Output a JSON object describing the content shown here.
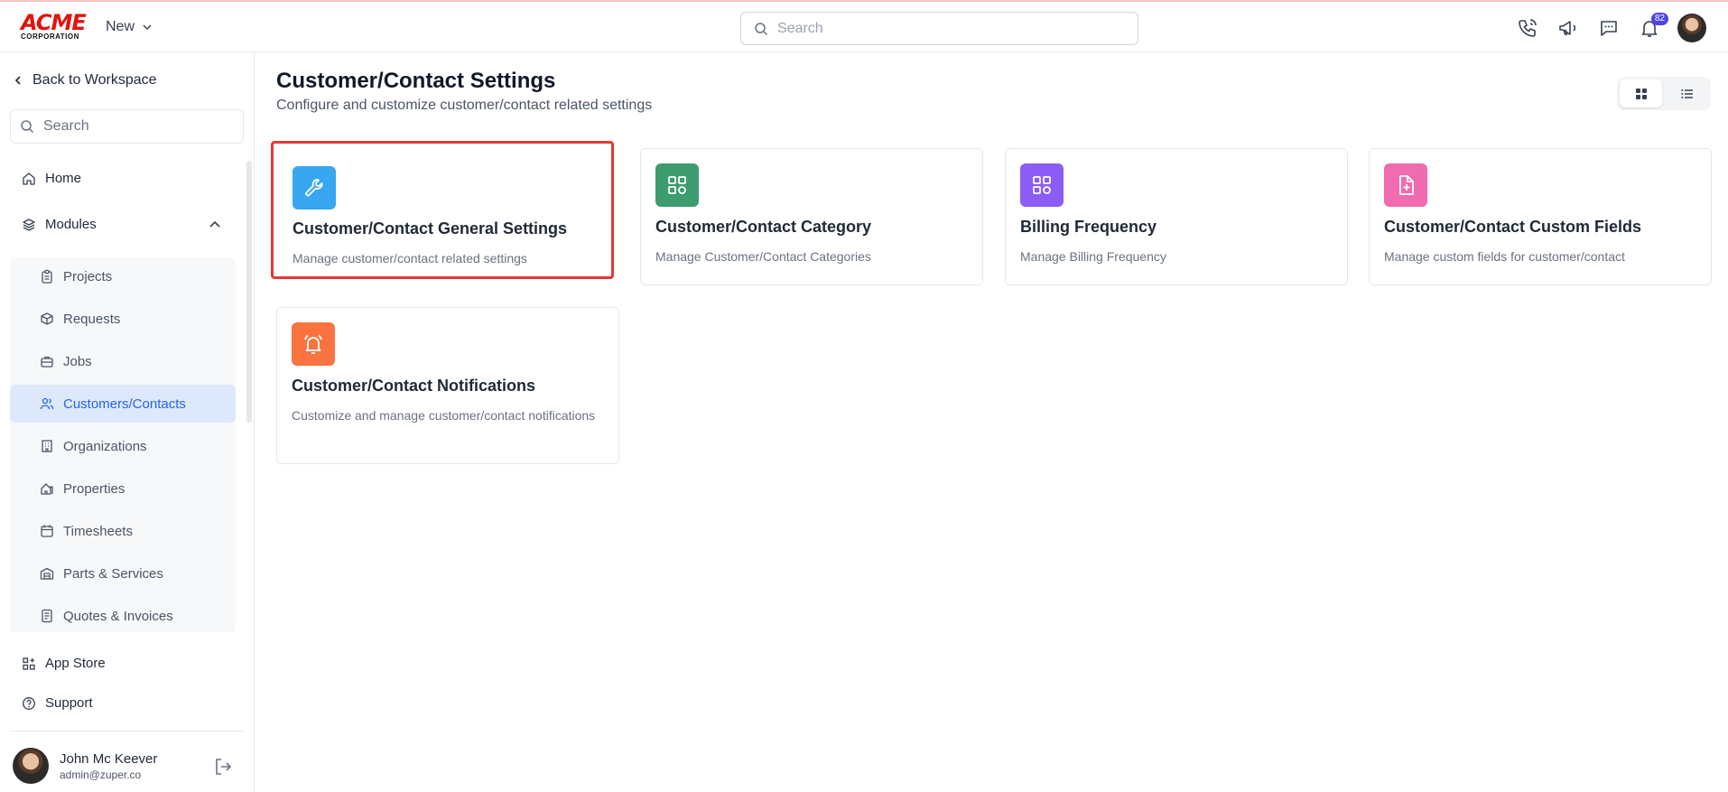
{
  "brand": {
    "logo_big": "ACME",
    "logo_small": "CORPORATION"
  },
  "header": {
    "new_label": "New",
    "search_placeholder": "Search",
    "notification_count": "82",
    "icons": [
      "phone-icon",
      "megaphone-icon",
      "chat-icon",
      "bell-icon",
      "user-avatar"
    ]
  },
  "sidebar": {
    "back_label": "Back to Workspace",
    "search_placeholder": "Search",
    "home_label": "Home",
    "modules_label": "Modules",
    "modules": [
      {
        "label": "Projects",
        "icon": "clipboard-icon"
      },
      {
        "label": "Requests",
        "icon": "box-icon"
      },
      {
        "label": "Jobs",
        "icon": "briefcase-icon"
      },
      {
        "label": "Customers/Contacts",
        "icon": "users-icon",
        "active": true
      },
      {
        "label": "Organizations",
        "icon": "building-icon"
      },
      {
        "label": "Properties",
        "icon": "property-icon"
      },
      {
        "label": "Timesheets",
        "icon": "calendar-icon"
      },
      {
        "label": "Parts & Services",
        "icon": "warehouse-icon"
      },
      {
        "label": "Quotes & Invoices",
        "icon": "invoice-icon"
      }
    ],
    "app_store_label": "App Store",
    "support_label": "Support",
    "user": {
      "name": "John Mc Keever",
      "email": "admin@zuper.co"
    }
  },
  "main": {
    "title": "Customer/Contact Settings",
    "subtitle": "Configure and customize customer/contact related settings",
    "view_modes": [
      "grid-view-icon",
      "list-view-icon"
    ],
    "cards": [
      {
        "title": "Customer/Contact General Settings",
        "desc": "Manage customer/contact related settings",
        "icon": "wrench-icon",
        "color": "#38a6f0",
        "highlighted": true
      },
      {
        "title": "Customer/Contact Category",
        "desc": "Manage Customer/Contact Categories",
        "icon": "category-icon",
        "color": "#3d9c6e"
      },
      {
        "title": "Billing Frequency",
        "desc": "Manage Billing Frequency",
        "icon": "category-icon",
        "color": "#8b5cf6"
      },
      {
        "title": "Customer/Contact Custom Fields",
        "desc": "Manage custom fields for customer/contact",
        "icon": "file-plus-icon",
        "color": "#f06bb0"
      },
      {
        "title": "Customer/Contact Notifications",
        "desc": "Customize and manage customer/contact notifications",
        "icon": "bell-ring-icon",
        "color": "#f97340"
      }
    ]
  }
}
